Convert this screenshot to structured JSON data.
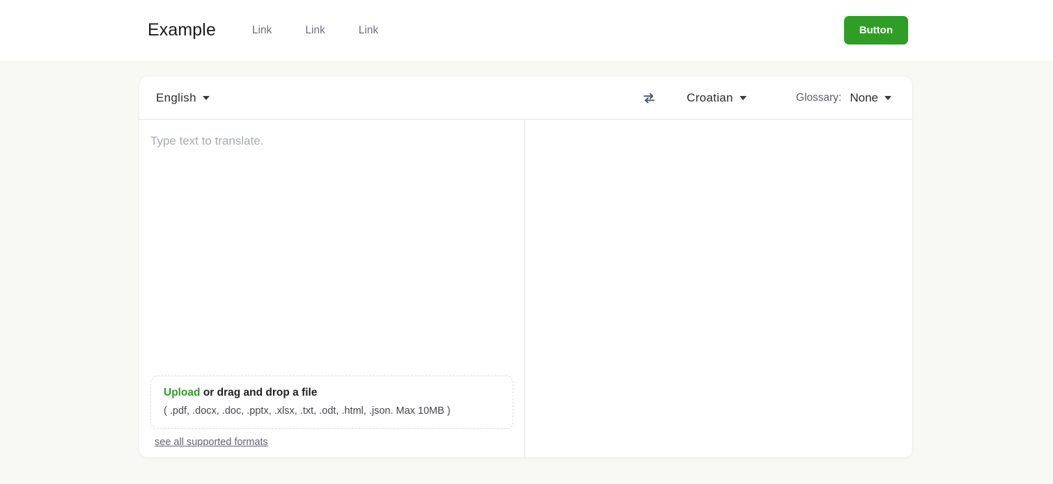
{
  "header": {
    "brand": "Example",
    "nav_links": [
      {
        "label": "Link"
      },
      {
        "label": "Link"
      },
      {
        "label": "Link"
      }
    ],
    "cta_label": "Button",
    "cta_color": "#2e9e26"
  },
  "translator": {
    "source_language": "English",
    "target_language": "Croatian",
    "swap_icon": "swap-horizontal-icon",
    "glossary_label": "Glossary:",
    "glossary_value": "None",
    "source_placeholder": "Type text to translate.",
    "source_value": "",
    "target_value": "",
    "dropzone": {
      "upload_word": "Upload",
      "title_rest": " or drag and drop a file",
      "formats": "( .pdf, .docx, .doc, .pptx, .xlsx, .txt, .odt, .html, .json. Max 10MB )",
      "upload_color": "#2e9e26"
    },
    "formats_link": "see all supported formats"
  },
  "theme": {
    "page_background": "#f8f9f4",
    "card_background": "#ffffff",
    "accent": "#2e9e26",
    "divider": "#e4e4e4"
  }
}
